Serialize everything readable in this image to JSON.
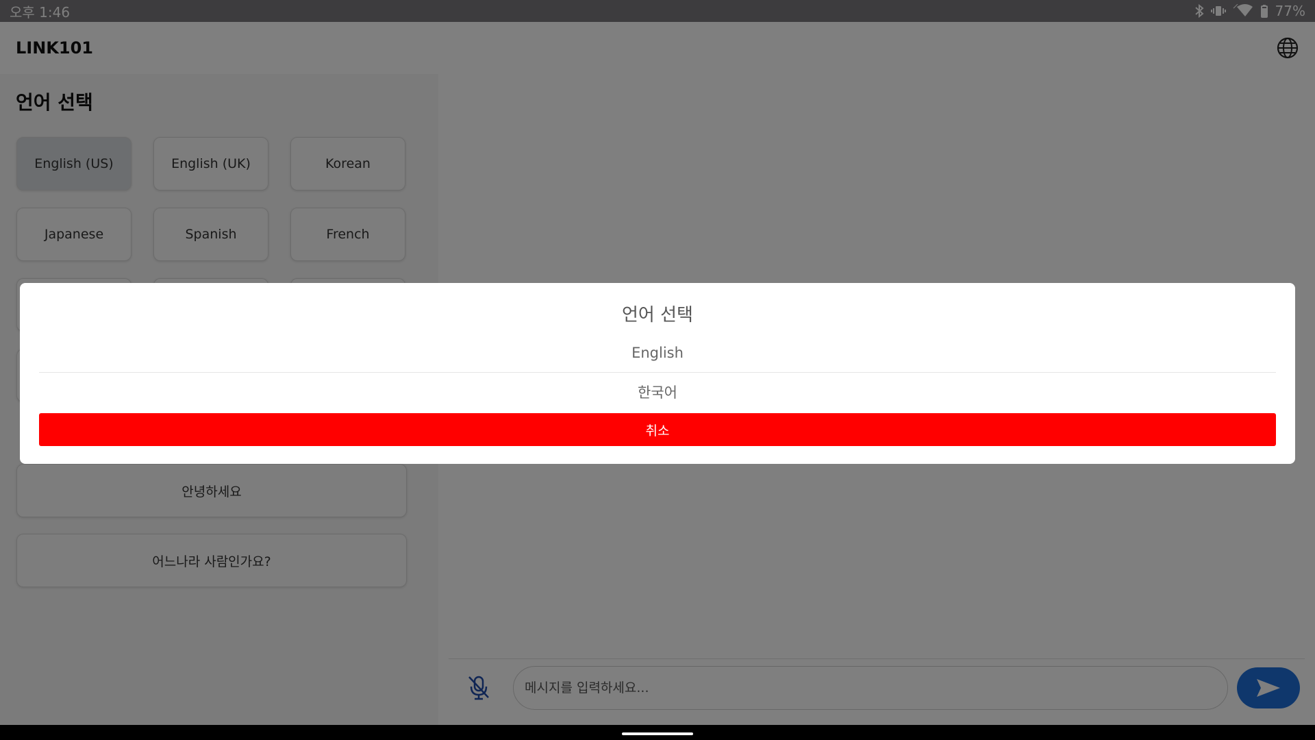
{
  "status_bar": {
    "time": "오후 1:46",
    "battery": "77%"
  },
  "app": {
    "title": "LINK101"
  },
  "language_section": {
    "title": "언어 선택",
    "buttons": [
      "English (US)",
      "English (UK)",
      "Korean",
      "Japanese",
      "Spanish",
      "French"
    ],
    "selected": "English (US)"
  },
  "phrases": [
    "안녕하세요",
    "어느나라 사람인가요?"
  ],
  "chat": {
    "input_placeholder": "메시지를 입력하세요..."
  },
  "dialog": {
    "title": "언어 선택",
    "options": [
      "English",
      "한국어"
    ],
    "cancel": "취소"
  },
  "colors": {
    "accent": "#1e6fd9",
    "cancel": "#ff0000",
    "scrim": "#000000"
  }
}
